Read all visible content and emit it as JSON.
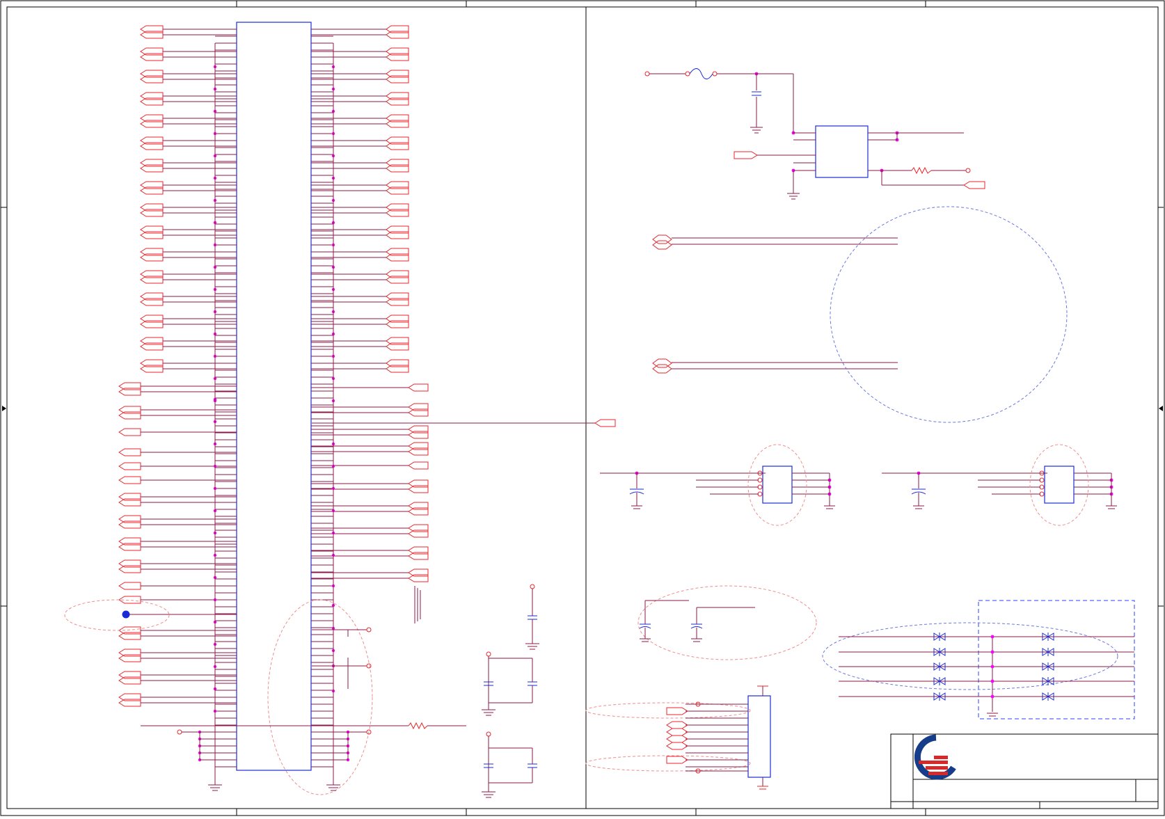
{
  "sheet": {
    "border_color": "#000000",
    "wire_color": "#8b1a4a",
    "port_color": "#e8252b",
    "component_color": "#1a2bd6",
    "junction_color": "#ff00ff",
    "region_dash_color": "#f08c8c",
    "region_blue_color": "#6a78e0",
    "title_block": {
      "logo_icon": "company-logo-icon",
      "logo_red": "#d62a2a",
      "logo_blue": "#153d8a"
    }
  }
}
